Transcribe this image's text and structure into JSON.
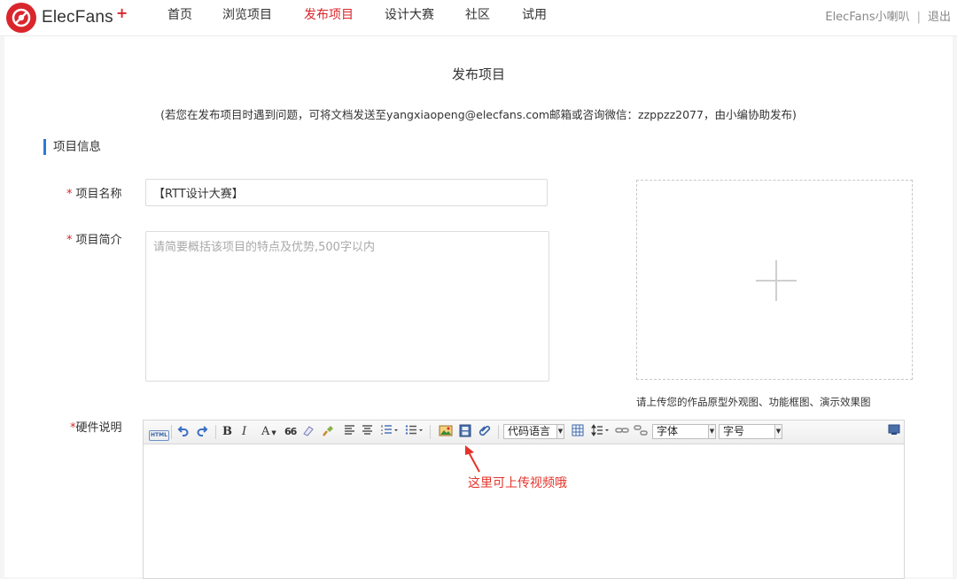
{
  "brand": {
    "name": "ElecFans",
    "plus": "+"
  },
  "nav": {
    "items": [
      {
        "label": "首页"
      },
      {
        "label": "浏览项目"
      },
      {
        "label": "发布项目"
      },
      {
        "label": "设计大赛"
      },
      {
        "label": "社区"
      },
      {
        "label": "试用"
      }
    ],
    "active_index": 2
  },
  "user": {
    "name": "ElecFans小喇叭",
    "separator": "|",
    "logout": "退出"
  },
  "page": {
    "title": "发布项目",
    "notice": "(若您在发布项目时遇到问题，可将文档发送至yangxiaopeng@elecfans.com邮箱或咨询微信：zzppzz2077，由小编协助发布)",
    "section_title": "项目信息"
  },
  "form": {
    "required_mark": "*",
    "name_label": "项目名称",
    "name_value": "【RTT设计大赛】",
    "intro_label": "项目简介",
    "intro_placeholder": "请简要概括该项目的特点及优势,500字以内",
    "hardware_label": "硬件说明",
    "upload_hint": "请上传您的作品原型外观图、功能框图、演示效果图"
  },
  "toolbar": {
    "html_label": "HTML",
    "bold": "B",
    "italic": "I",
    "font_color": "A",
    "quote": "66",
    "code_language": "代码语言",
    "font_family": "字体",
    "font_size": "字号"
  },
  "annotation": {
    "text": "这里可上传视频哦"
  },
  "colors": {
    "accent": "#d9262c",
    "section_bar": "#2c7ad6",
    "annotation": "#e5332a"
  }
}
